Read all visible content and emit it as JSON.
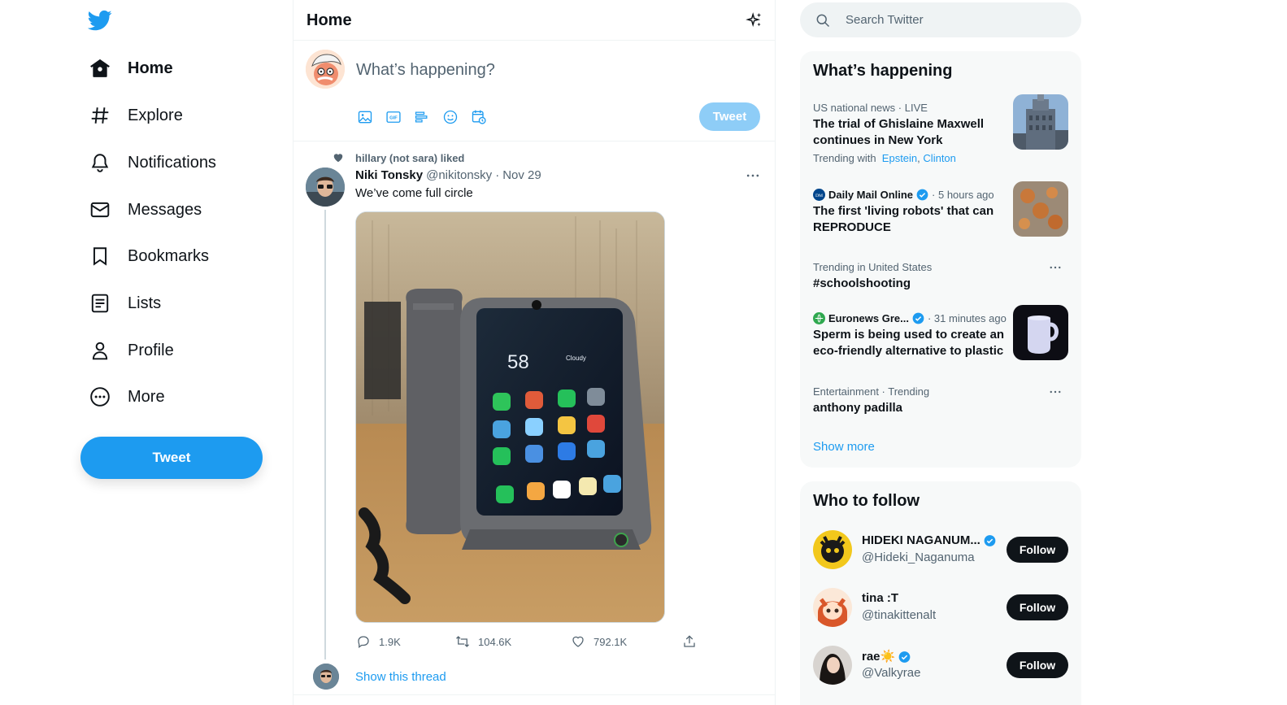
{
  "nav": {
    "logo_icon": "twitter-bird-icon",
    "items": [
      {
        "label": "Home",
        "icon": "home-icon",
        "active": true
      },
      {
        "label": "Explore",
        "icon": "hashtag-icon"
      },
      {
        "label": "Notifications",
        "icon": "bell-icon"
      },
      {
        "label": "Messages",
        "icon": "envelope-icon"
      },
      {
        "label": "Bookmarks",
        "icon": "bookmark-icon"
      },
      {
        "label": "Lists",
        "icon": "list-icon"
      },
      {
        "label": "Profile",
        "icon": "person-icon"
      },
      {
        "label": "More",
        "icon": "more-circle-icon"
      }
    ],
    "tweet_button": "Tweet"
  },
  "header": {
    "title": "Home",
    "icon": "sparkle-icon"
  },
  "composer": {
    "placeholder": "What’s happening?",
    "tools": [
      "image-icon",
      "gif-icon",
      "poll-icon",
      "emoji-icon",
      "schedule-icon"
    ],
    "tweet_button": "Tweet"
  },
  "tweet": {
    "social_context": "hillary (not sara) liked",
    "name": "Niki Tonsky",
    "handle": "@nikitonsky",
    "separator": "·",
    "date": "Nov 29",
    "text": "We’ve come full circle",
    "actions": {
      "replies": "1.9K",
      "retweets": "104.6K",
      "likes": "792.1K"
    },
    "show_thread": "Show this thread",
    "phone_screen_time": "58",
    "phone_screen_weather": "Cloudy"
  },
  "search": {
    "placeholder": "Search Twitter"
  },
  "trends": {
    "title": "What’s happening",
    "items": [
      {
        "context": "US national news · LIVE",
        "headline": "The trial of Ghislaine Maxwell continues in New York",
        "trending_with_label": "Trending with",
        "trending_with_1": "Epstein",
        "trending_with_sep": ",",
        "trending_with_2": "Clinton"
      },
      {
        "source": "Daily Mail Online",
        "time": "· 5 hours ago",
        "headline": "The first 'living robots' that can REPRODUCE"
      },
      {
        "context": "Trending in United States",
        "headline": "#schoolshooting"
      },
      {
        "source": "Euronews Gre...",
        "time": "· 31 minutes ago",
        "headline": "Sperm is being used to create an eco-friendly alternative to plastic"
      },
      {
        "context": "Entertainment · Trending",
        "headline": "anthony padilla"
      }
    ],
    "show_more": "Show more"
  },
  "who_to_follow": {
    "title": "Who to follow",
    "users": [
      {
        "name": "HIDEKI NAGANUM...",
        "handle": "@Hideki_Naganuma",
        "verified": true,
        "button": "Follow"
      },
      {
        "name": "tina :T",
        "handle": "@tinakittenalt",
        "verified": false,
        "button": "Follow"
      },
      {
        "name": "rae☀️",
        "handle": "@Valkyrae",
        "verified": true,
        "button": "Follow"
      }
    ]
  },
  "colors": {
    "accent": "#1d9bf0",
    "accent_disabled": "#8ecdf7",
    "text_primary": "#0f1419",
    "text_secondary": "#536471",
    "panel_bg": "#f7f9f9"
  }
}
